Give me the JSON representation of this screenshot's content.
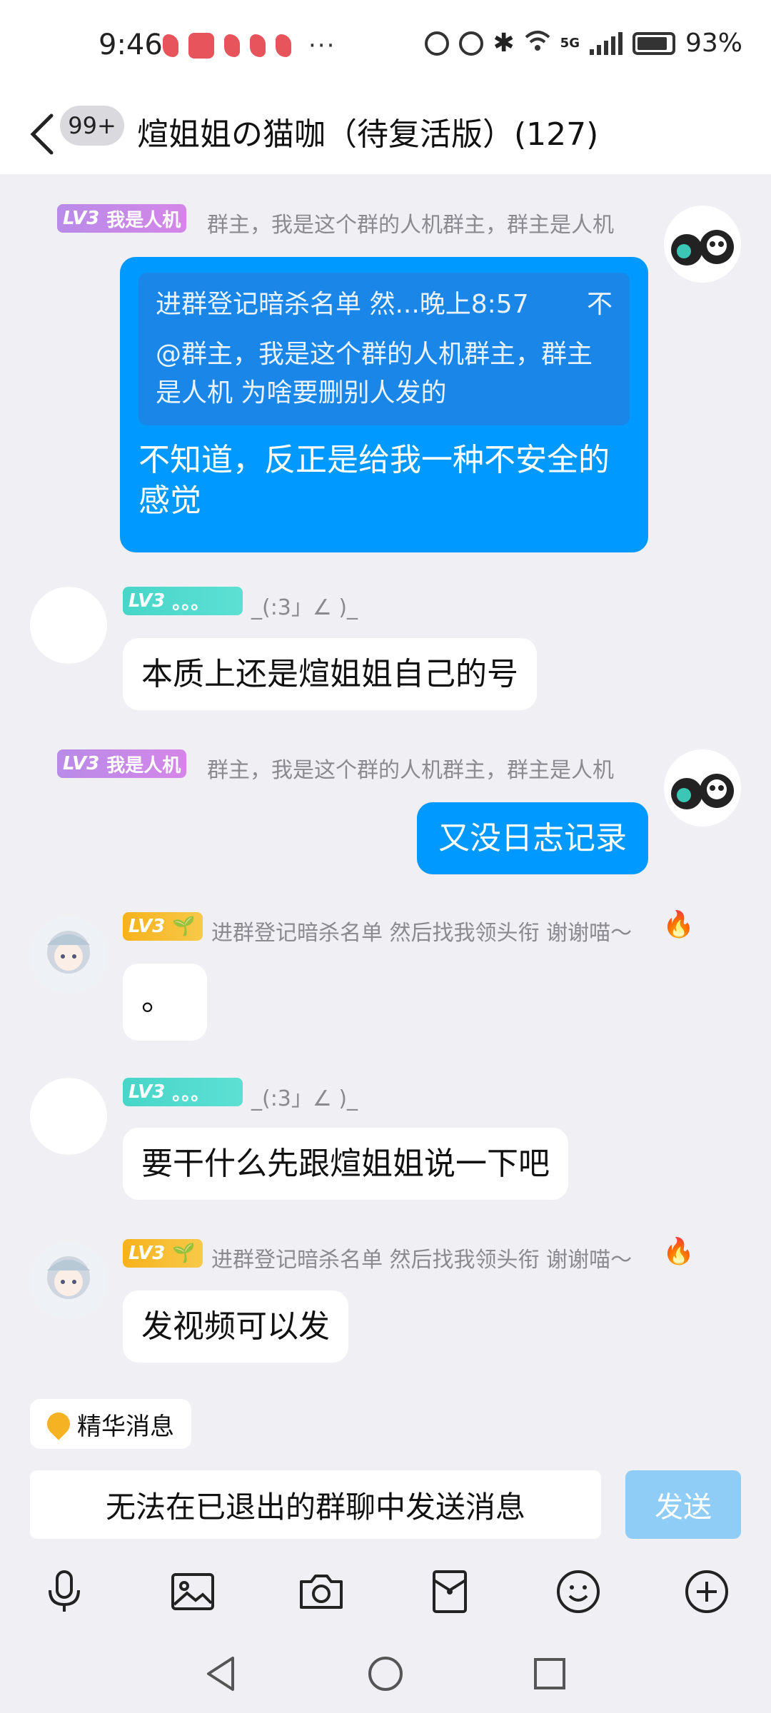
{
  "status_bar": {
    "time": "9:46",
    "more": "···",
    "battery": "93%",
    "network": "5G"
  },
  "header": {
    "unread_badge": "99+",
    "title": "煊姐姐の猫咖（待复活版）(127)"
  },
  "messages": [
    {
      "direction": "out",
      "level": "LV3",
      "sender": "我是人机",
      "title": "群主，我是这个群的人机群主，群主是人机",
      "quote_header": "进群登记暗杀名单 然...晚上8:57",
      "quote_status": "不",
      "quote_text": "@群主，我是这个群的人机群主，群主是人机 为啥要删别人发的",
      "text": "不知道，反正是给我一种不安全的感觉"
    },
    {
      "direction": "in",
      "level": "LV3",
      "sender": "。。。",
      "title": "_(:3」∠ )_",
      "text": "本质上还是煊姐姐自己的号"
    },
    {
      "direction": "out",
      "level": "LV3",
      "sender": "我是人机",
      "title": "群主，我是这个群的人机群主，群主是人机",
      "text": "又没日志记录"
    },
    {
      "direction": "in",
      "level": "LV3",
      "sender": "🌱",
      "title": "进群登记暗杀名单 然后找我领头衔 谢谢喵～",
      "text": "。"
    },
    {
      "direction": "in",
      "level": "LV3",
      "sender": "。。。",
      "title": "_(:3」∠ )_",
      "text": "要干什么先跟煊姐姐说一下吧"
    },
    {
      "direction": "in",
      "level": "LV3",
      "sender": "🌱",
      "title": "进群登记暗杀名单 然后找我领头衔 谢谢喵～",
      "text": "发视频可以发"
    }
  ],
  "featured": {
    "label": "精华消息"
  },
  "input": {
    "text": "无法在已退出的群聊中发送消息"
  },
  "send_button": "发送",
  "toolbar_icons": [
    "microphone-icon",
    "image-icon",
    "camera-icon",
    "red-packet-icon",
    "emoji-icon",
    "plus-icon"
  ],
  "colors": {
    "accent": "#0099ff",
    "send_disabled": "#8fcdf7",
    "background": "#efeff4"
  }
}
